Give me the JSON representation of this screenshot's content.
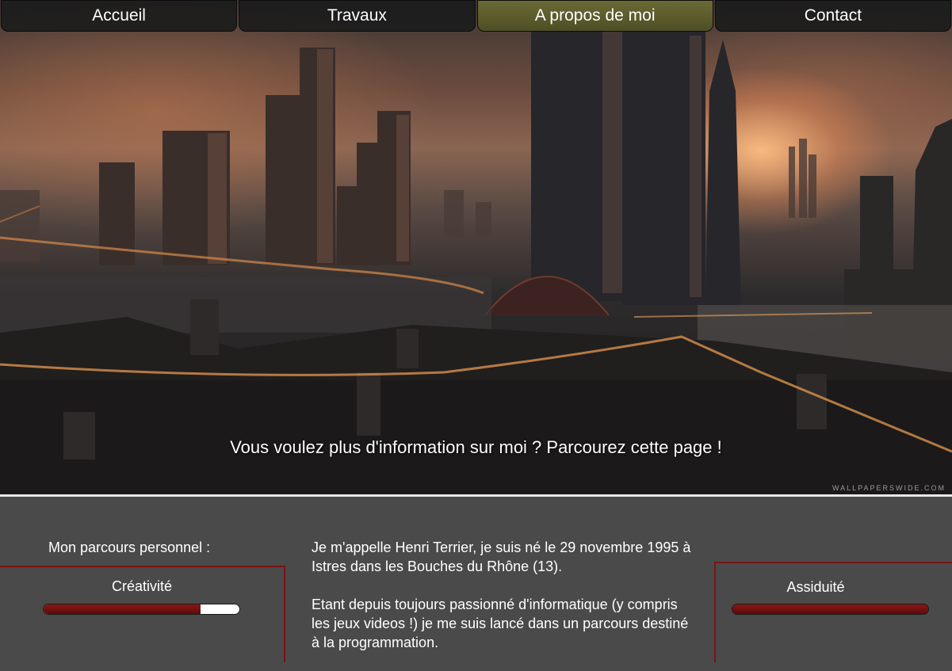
{
  "nav": {
    "tabs": [
      {
        "label": "Accueil",
        "active": false
      },
      {
        "label": "Travaux",
        "active": false
      },
      {
        "label": "A propos de moi",
        "active": true
      },
      {
        "label": "Contact",
        "active": false
      }
    ],
    "active_color": "#5d5d2d"
  },
  "hero": {
    "tagline": "Vous voulez plus d'information sur moi ? Parcourez cette page !",
    "watermark": "WALLPAPERSWIDE.COM"
  },
  "about": {
    "parcours_title": "Mon parcours personnel :",
    "bio_paragraphs": [
      "Je m'appelle Henri Terrier, je suis né le 29 novembre 1995 à Istres dans les Bouches du Rhône (13).",
      "Etant depuis toujours passionné d'informatique (y compris les jeux videos !) je me suis lancé dans un parcours destiné à la programmation."
    ]
  },
  "skills": [
    {
      "label": "Créativité",
      "level": 0.8
    },
    {
      "label": "Assiduité",
      "level": 1.0
    }
  ],
  "colors": {
    "panel_bg": "#4a4a4a",
    "accent_red": "#7a1414"
  }
}
